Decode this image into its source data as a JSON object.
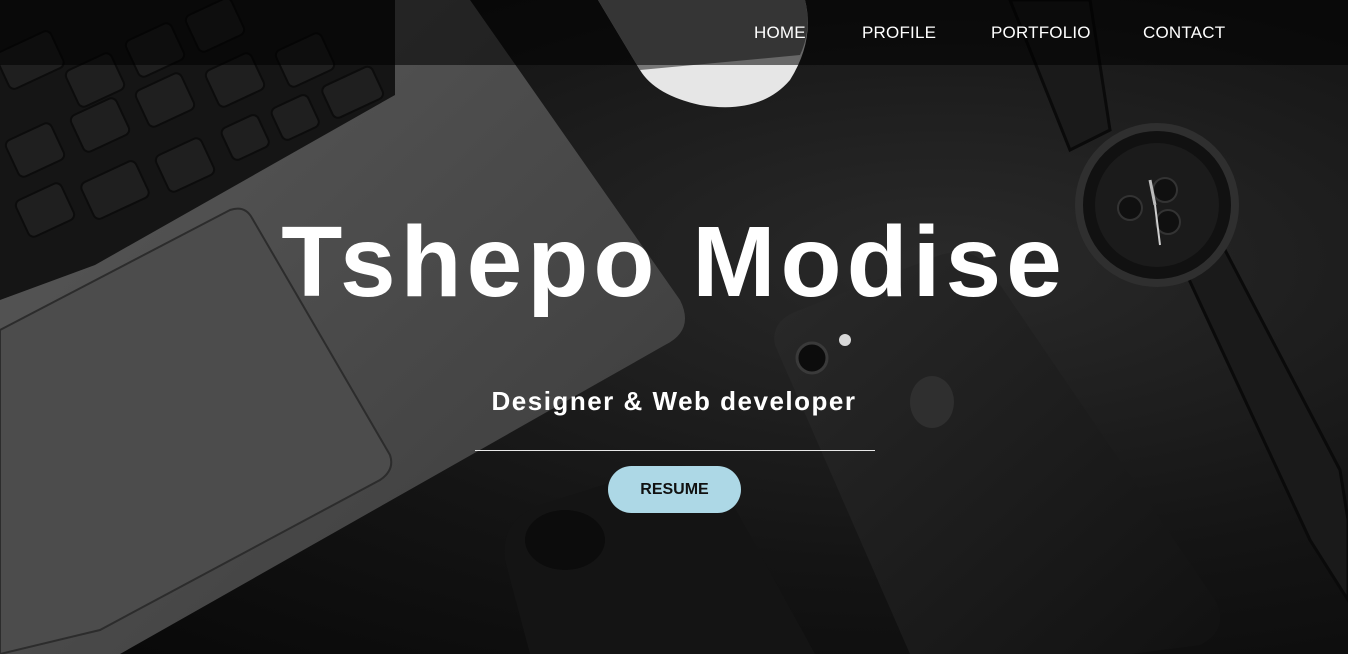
{
  "nav": {
    "items": [
      {
        "label": "HOME"
      },
      {
        "label": "PROFILE"
      },
      {
        "label": "PORTFOLIO"
      },
      {
        "label": "CONTACT"
      }
    ]
  },
  "hero": {
    "name": "Tshepo Modise",
    "subtitle": "Designer & Web developer",
    "resume_label": "RESUME",
    "background_image": "desk with laptop, mouse, phones and watch (grayscale)"
  },
  "colors": {
    "button_bg": "#add8e6",
    "text": "#ffffff",
    "nav_bg": "rgba(0,0,0,0.55)"
  }
}
